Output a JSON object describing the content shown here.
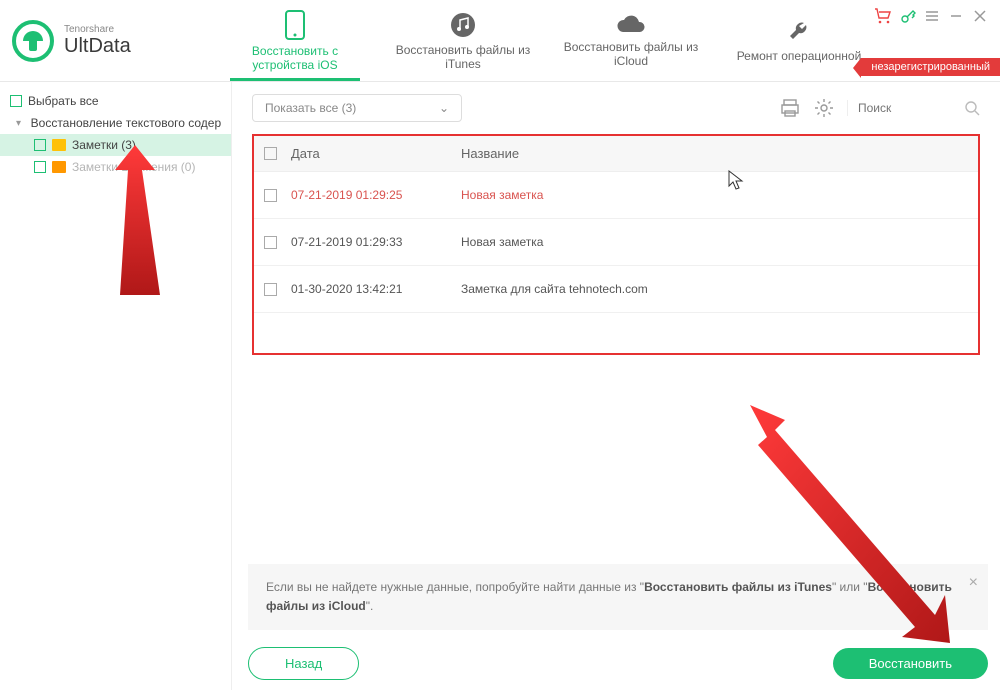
{
  "brand": {
    "company": "Tenorshare",
    "product": "UltData"
  },
  "tabs": [
    {
      "label": "Восстановить с устройства iOS",
      "active": true
    },
    {
      "label": "Восстановить файлы из iTunes",
      "active": false
    },
    {
      "label": "Восстановить файлы из iCloud",
      "active": false
    },
    {
      "label": "Ремонт операционной",
      "active": false
    }
  ],
  "badge": "незарегистрированный",
  "sidebar": {
    "select_all": "Выбрать все",
    "group": "Восстановление текстового содержимо",
    "items": [
      {
        "label": "Заметки (3)",
        "selected": true,
        "muted": false
      },
      {
        "label": "Заметки Вложения (0)",
        "selected": false,
        "muted": true
      }
    ]
  },
  "toolbar": {
    "dropdown": "Показать все  (3)",
    "search_placeholder": "Поиск"
  },
  "table": {
    "headers": {
      "date": "Дата",
      "title": "Название"
    },
    "rows": [
      {
        "date": "07-21-2019 01:29:25",
        "title": "Новая заметка",
        "deleted": true
      },
      {
        "date": "07-21-2019 01:29:33",
        "title": "Новая заметка",
        "deleted": false
      },
      {
        "date": "01-30-2020 13:42:21",
        "title": "Заметка для сайта tehnotech.com",
        "deleted": false
      }
    ]
  },
  "hint": {
    "prefix": "Если вы не найдете нужные данные, попробуйте найти данные из \"",
    "opt1": "Восстановить файлы из iTunes",
    "mid": "\" или \"",
    "opt2": "Восстановить файлы из iCloud",
    "suffix": "\"."
  },
  "buttons": {
    "back": "Назад",
    "recover": "Восстановить"
  }
}
